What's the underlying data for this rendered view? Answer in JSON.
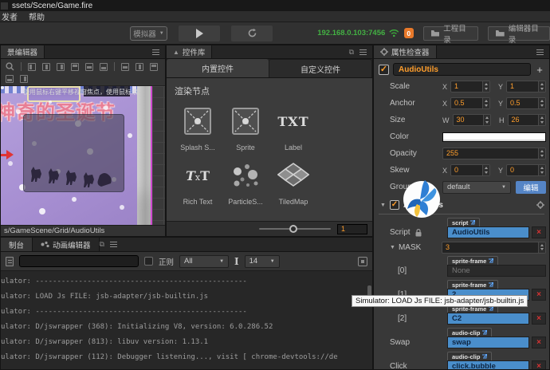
{
  "window": {
    "title": "ssets/Scene/Game.fire"
  },
  "menubar": {
    "items": [
      "发者",
      "帮助"
    ]
  },
  "toolbar": {
    "device": "模拟器",
    "ip": "192.168.0.103:7456",
    "badge": "0",
    "project_dir": "工程目录",
    "editor_dir": "编辑器目录"
  },
  "scene": {
    "tab": "景编辑器",
    "hint": "使用鼠标右键平移视窗焦点，使用鼠标滚轮缩放视图",
    "game_title": "神奇的圣诞节",
    "breadcrumb": "s/GameScene/Grid/AudioUtils"
  },
  "widgets": {
    "tab": "控件库",
    "tab_builtin": "内置控件",
    "tab_custom": "自定义控件",
    "section": "渲染节点",
    "items": [
      {
        "label": "Splash S..."
      },
      {
        "label": "Sprite"
      },
      {
        "label": "Label",
        "glyph": "TXT"
      },
      {
        "label": "Rich Text",
        "g1": "T",
        "g2": "x",
        "g3": "T"
      },
      {
        "label": "ParticleS..."
      },
      {
        "label": "TiledMap"
      }
    ],
    "zoom_value": "1"
  },
  "labels": {
    "x": "X",
    "y": "Y",
    "w": "W",
    "h": "H"
  },
  "inspector": {
    "tab": "属性检查器",
    "node_name": "AudioUtils",
    "scale": {
      "label": "Scale",
      "x": "1",
      "y": "1"
    },
    "anchor": {
      "label": "Anchor",
      "x": "0.5",
      "y": "0.5"
    },
    "size": {
      "label": "Size",
      "w": "30",
      "h": "26"
    },
    "color": {
      "label": "Color",
      "value": "#FFFFFF"
    },
    "opacity": {
      "label": "Opacity",
      "value": "255"
    },
    "skew": {
      "label": "Skew",
      "x": "0",
      "y": "0"
    },
    "group": {
      "label": "Group",
      "value": "default",
      "edit": "编辑"
    },
    "component": {
      "name": "AudioUtils",
      "script_label": "Script",
      "script_chip": "script",
      "script_value": "AudioUtils",
      "mask_label": "MASK",
      "mask_value": "3",
      "el0_label": "[0]",
      "el0_chip": "sprite-frame",
      "el0_value": "None",
      "el1_label": "[1]",
      "el1_chip": "sprite-frame",
      "el1_value": "2",
      "el2_label": "[2]",
      "el2_chip": "sprite-frame",
      "el2_value": "C2",
      "swap_label": "Swap",
      "swap_chip": "audio-clip",
      "swap_value": "swap",
      "click_label": "Click",
      "click_chip": "audio-clip",
      "click_value": "click.bubble"
    }
  },
  "console": {
    "tab": "制台",
    "tab_animation": "动画编辑器",
    "regex_label": "正则",
    "filter_value": "All",
    "font_size_value": "14",
    "lines": [
      "ulator: -------------------------------------------------",
      "ulator: LOAD Js FILE: jsb-adapter/jsb-builtin.js",
      "ulator: -------------------------------------------------",
      "ulator: D/jswrapper (368): Initializing V8, version: 6.0.286.52",
      "ulator: D/jswrapper (813): libuv version: 1.13.1",
      "ulator: D/jswrapper (112): Debugger listening..., visit [ chrome-devtools://de"
    ]
  },
  "tooltip": "Simulator: LOAD Js FILE: jsb-adapter/jsb-builtin.js",
  "colors": {
    "accent_orange": "#ff9e2c",
    "asset_field_blue": "#4a8ecb",
    "ip_green": "#43b043",
    "edit_button_blue": "#5585c6",
    "badge_orange": "#e8792a",
    "scene_purple": "#a78fd2",
    "game_title_pink": "#e87e95",
    "scene_bounds_magenta": "#cf49cf"
  }
}
